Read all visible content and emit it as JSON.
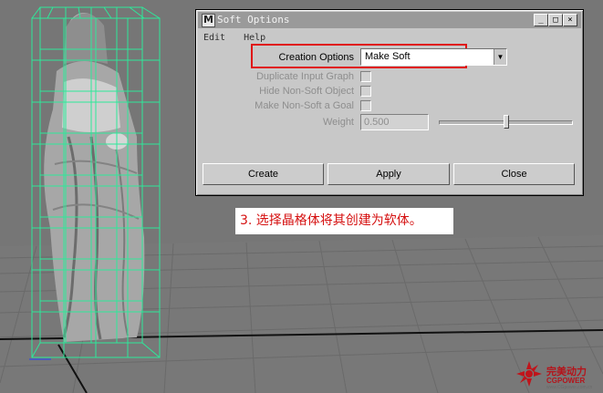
{
  "dialog": {
    "title": "Soft Options",
    "menu": [
      "Edit",
      "Help"
    ],
    "creation_options_label": "Creation Options",
    "creation_options_value": "Make Soft",
    "options": [
      {
        "label": "Duplicate Input Graph",
        "checked": false
      },
      {
        "label": "Hide Non-Soft Object",
        "checked": false
      },
      {
        "label": "Make Non-Soft a Goal",
        "checked": false
      }
    ],
    "weight_label": "Weight",
    "weight_value": "0.500",
    "weight_fraction": 0.5,
    "buttons": {
      "create": "Create",
      "apply": "Apply",
      "close": "Close"
    },
    "window_buttons": {
      "minimize": "_",
      "maximize": "□",
      "close": "×"
    }
  },
  "caption": "3.  选择晶格体将其创建为软体。",
  "watermark": {
    "brand": "完美动力",
    "sub": "CGPOWER",
    "url": "www.CGpower.com.cn",
    "logo_color": "#c0141b"
  },
  "colors": {
    "highlight": "#e01515",
    "lattice": "#2ee89a",
    "background": "#767676"
  }
}
